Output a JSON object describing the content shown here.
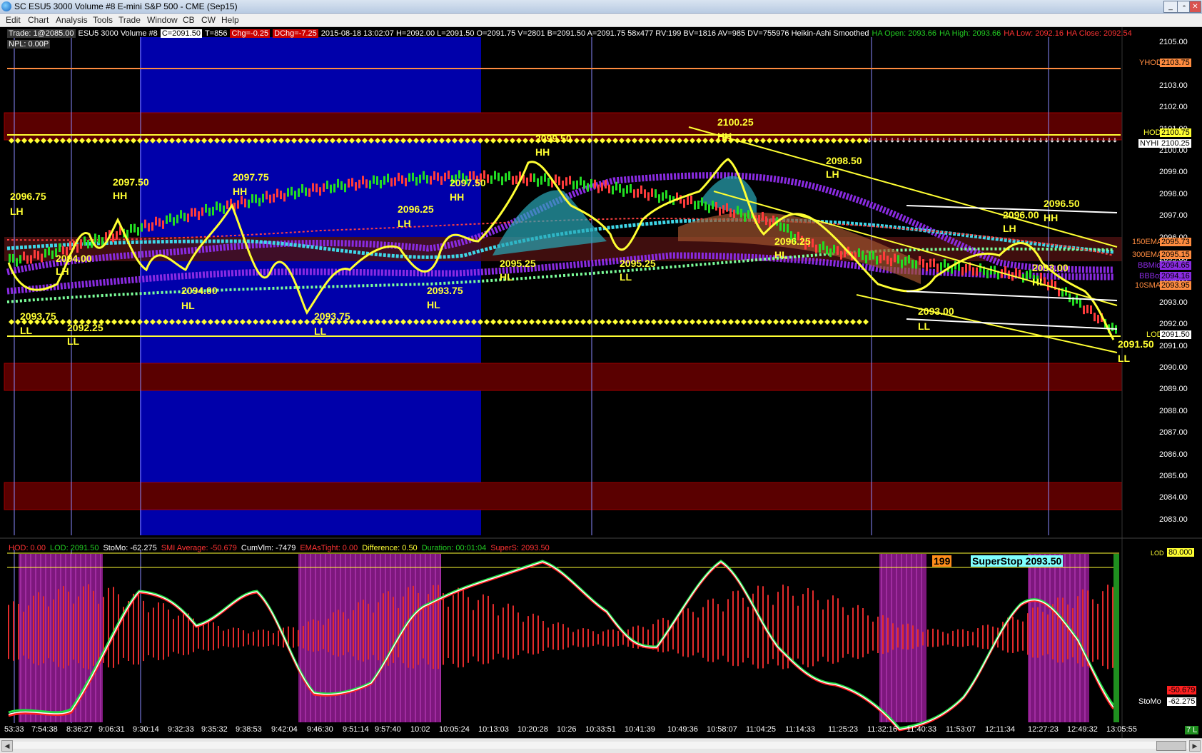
{
  "window": {
    "title": "SC ESU5  3000 Volume  #8  E-mini S&P 500 - CME (Sep15)",
    "buttons": [
      "_",
      "▫",
      "✕"
    ]
  },
  "menu": [
    "Edit",
    "Chart",
    "Analysis",
    "Tools",
    "Trade",
    "Window",
    "CB",
    "CW",
    "Help"
  ],
  "header": {
    "trade": "Trade: 1@2085.00",
    "symbol": "ESU5  3000 Volume  #8",
    "c": "C=2091.50",
    "t": "T=856",
    "chg": "Chg=-0.25",
    "dchg": "DChg=-7.25",
    "stats": "2015-08-18 13:02:07 H=2092.00 L=2091.50 O=2091.75 V=2801 B=2091.50 A=2091.75 58x477 RV:199 BV=1816 AV=985 DV=755976  Heikin-Ashi Smoothed",
    "ha_open": "HA Open: 2093.66",
    "ha_high": "HA High: 2093.66",
    "ha_low": "HA Low: 2092.16",
    "ha_close": "HA Close: 2092.54",
    "npl": "NPL: 0.00P"
  },
  "price_axis": [
    "2105.00",
    "2104.00",
    "2103.00",
    "2102.00",
    "2101.00",
    "2100.00",
    "2099.00",
    "2098.00",
    "2097.00",
    "2096.00",
    "2095.00",
    "2094.00",
    "2093.00",
    "2092.00",
    "2091.00",
    "2090.00",
    "2089.00",
    "2088.00",
    "2087.00",
    "2086.00",
    "2085.00",
    "2084.00",
    "2083.00"
  ],
  "price_tags": {
    "yhod_label": "YHOD",
    "yhod_value": "2103.75",
    "hod_label": "HOD",
    "hod_value": "2100.75",
    "nyhi_label": "NYHI",
    "nyhi_value": "2100.25",
    "ema150_label": "150EMA",
    "ema150_value": "2095.73",
    "ema300_label": "300EMA",
    "ema300_value": "2095.15",
    "bbmid_label": "BBMid",
    "bbmid_value": "2094.65",
    "bbbot_label": "BBBot",
    "bbbot_value": "2094.16",
    "sma_label": "10SMA",
    "sma_value": "2093.95",
    "lod_label": "LOD",
    "lod_value": "2091.50"
  },
  "annotations": {
    "a1_v": "2096.75",
    "a1_t": "LH",
    "a2_v": "2097.50",
    "a2_t": "HH",
    "a3_v": "2097.75",
    "a3_t": "HH",
    "a4_v": "2094.00",
    "a4_t": "LH",
    "a5_v": "2093.75",
    "a5_t": "LL",
    "a6_v": "2092.25",
    "a6_t": "LL",
    "a7_v": "2094.00",
    "a7_t": "HL",
    "a8_v": "2093.75",
    "a8_t": "LL",
    "a9_v": "2096.25",
    "a9_t": "LH",
    "a10_v": "2097.50",
    "a10_t": "HH",
    "a11_v": "2099.50",
    "a11_t": "HH",
    "a12_v": "2095.25",
    "a12_t": "HL",
    "a13_v": "2093.75",
    "a13_t": "HL",
    "a14_v": "2095.25",
    "a14_t": "LL",
    "a15_v": "2100.25",
    "a15_t": "HH",
    "a16_v": "2098.50",
    "a16_t": "LH",
    "a17_v": "2096.25",
    "a17_t": "HL",
    "a18_v": "2096.00",
    "a18_t": "LH",
    "a19_v": "2096.50",
    "a19_t": "HH",
    "a20_v": "2093.00",
    "a20_t": "HL",
    "a21_v": "2093.00",
    "a21_t": "LL",
    "a22_v": "2091.50",
    "a22_t": "LL"
  },
  "sub_header": {
    "hod": "HOD: 0.00",
    "lod": "LOD: 2091.50",
    "stomo": "StoMo: -62.275",
    "smi": "SMI Average: -50.679",
    "cumvlm": "CumVlm: -7479",
    "emas": "EMAsTight: 0.00",
    "diff": "Difference: 0.50",
    "dur": "Duration: 00:01:04",
    "supers": "SuperS: 2093.50"
  },
  "sub_panel": {
    "counter": "199",
    "superstop": "SuperStop 2093.50",
    "lod_tag": "LOD",
    "level_80": "80.000",
    "smi_value": "-50.679",
    "stomo_label": "StoMo",
    "stomo_value": "-62.275"
  },
  "time_axis": [
    "53:33",
    "7:54:38",
    "8:36:27",
    "9:06:31",
    "9:30:14",
    "9:32:33",
    "9:35:32",
    "9:38:53",
    "9:42:04",
    "9:46:30",
    "9:51:14",
    "9:57:40",
    "10:02",
    "10:05:24",
    "10:13:03",
    "10:20:28",
    "10:26",
    "10:33:51",
    "10:41:39",
    "10:49:36",
    "10:58:07",
    "11:04:25",
    "11:14:33",
    "11:25:23",
    "11:32:16",
    "11:40:33",
    "11:53:07",
    "12:11:34",
    "12:27:23",
    "12:49:32",
    "13:05:55"
  ],
  "scroll_corner": "7 L",
  "colors": {
    "accent_yellow": "#ffff33",
    "purple_band": "#8a2be2",
    "cyan_band": "#3fd7e8",
    "zone_red": "#5a0000",
    "session_blue": "#0000aa",
    "chg_red": "#cc0000",
    "ha_green": "#22cc22",
    "ha_red": "#ff3333"
  }
}
